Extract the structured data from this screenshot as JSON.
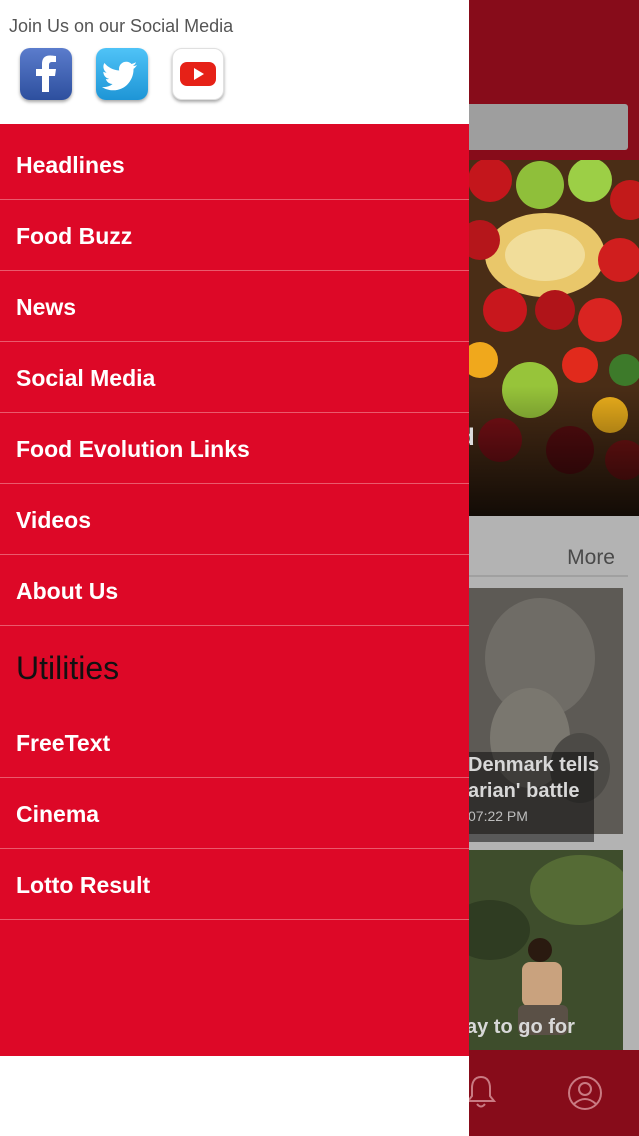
{
  "social": {
    "title": "Join Us on our Social Media",
    "icons": [
      {
        "name": "facebook-icon",
        "color": "#3b5998"
      },
      {
        "name": "twitter-icon",
        "color": "#1da1f2"
      },
      {
        "name": "youtube-icon",
        "color": "#e62117"
      }
    ]
  },
  "menu": {
    "primary": [
      {
        "label": "Headlines"
      },
      {
        "label": "Food Buzz"
      },
      {
        "label": "News"
      },
      {
        "label": "Social Media"
      },
      {
        "label": "Food Evolution Links"
      },
      {
        "label": "Videos"
      },
      {
        "label": "About Us"
      }
    ],
    "utilities_heading": "Utilities",
    "utilities": [
      {
        "label": "FreeText"
      },
      {
        "label": "Cinema"
      },
      {
        "label": "Lotto Result"
      }
    ]
  },
  "background": {
    "hero_caption_fragment": "d",
    "section_more": "More",
    "card1": {
      "line1": "Denmark tells",
      "line2": "arian' battle",
      "time": "07:22 PM"
    },
    "card2": {
      "line1": "ay to go for"
    }
  },
  "colors": {
    "menu_red": "#dd0827",
    "header_dark_red": "#870c1a",
    "divider": "#ea5a6c"
  }
}
